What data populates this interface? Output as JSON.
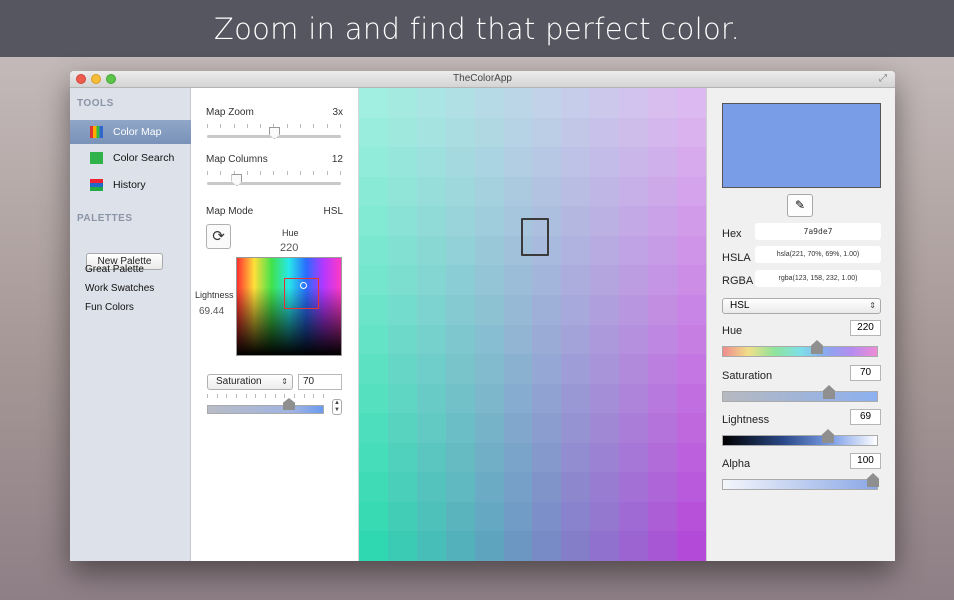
{
  "banner": {
    "text": "Zoom in and find that perfect color."
  },
  "window": {
    "title": "TheColorApp"
  },
  "sidebar": {
    "tools_heading": "TOOLS",
    "tools": [
      {
        "label": "Color Map",
        "icon": "color-map-icon"
      },
      {
        "label": "Color Search",
        "icon": "color-search-icon"
      },
      {
        "label": "History",
        "icon": "history-icon"
      }
    ],
    "palettes_heading": "PALETTES",
    "new_palette": "New Palette",
    "palettes": [
      "Great Palette",
      "Work Swatches",
      "Fun Colors"
    ]
  },
  "controls": {
    "map_zoom_label": "Map Zoom",
    "map_zoom_value": "3x",
    "map_zoom_level": 0.5,
    "map_columns_label": "Map Columns",
    "map_columns_value": "12",
    "map_columns_level": 0.22,
    "map_mode_label": "Map Mode",
    "map_mode_value": "HSL",
    "hue_label": "Hue",
    "hue_value": "220",
    "lightness_label": "Lightness",
    "lightness_value": "69.44",
    "axis_select": "Saturation",
    "axis_value": "70"
  },
  "colormap": {
    "columns": 12,
    "rows": 16,
    "top_left": "#a0efe0",
    "top_right": "#dcb9f0",
    "bottom_left": "#2fd8b0",
    "bottom_right": "#b44ad8",
    "center": "#7a9de7"
  },
  "color": {
    "swatch": "#7a9de7",
    "hex_label": "Hex",
    "hex": "7a9de7",
    "hsla_label": "HSLA",
    "hsla": "hsla(221, 70%, 69%, 1.00)",
    "rgba_label": "RGBA",
    "rgba": "rgba(123, 158, 232, 1.00)",
    "model": "HSL",
    "hue_label": "Hue",
    "hue": "220",
    "saturation_label": "Saturation",
    "saturation": "70",
    "lightness_label": "Lightness",
    "lightness": "69",
    "alpha_label": "Alpha",
    "alpha": "100"
  }
}
